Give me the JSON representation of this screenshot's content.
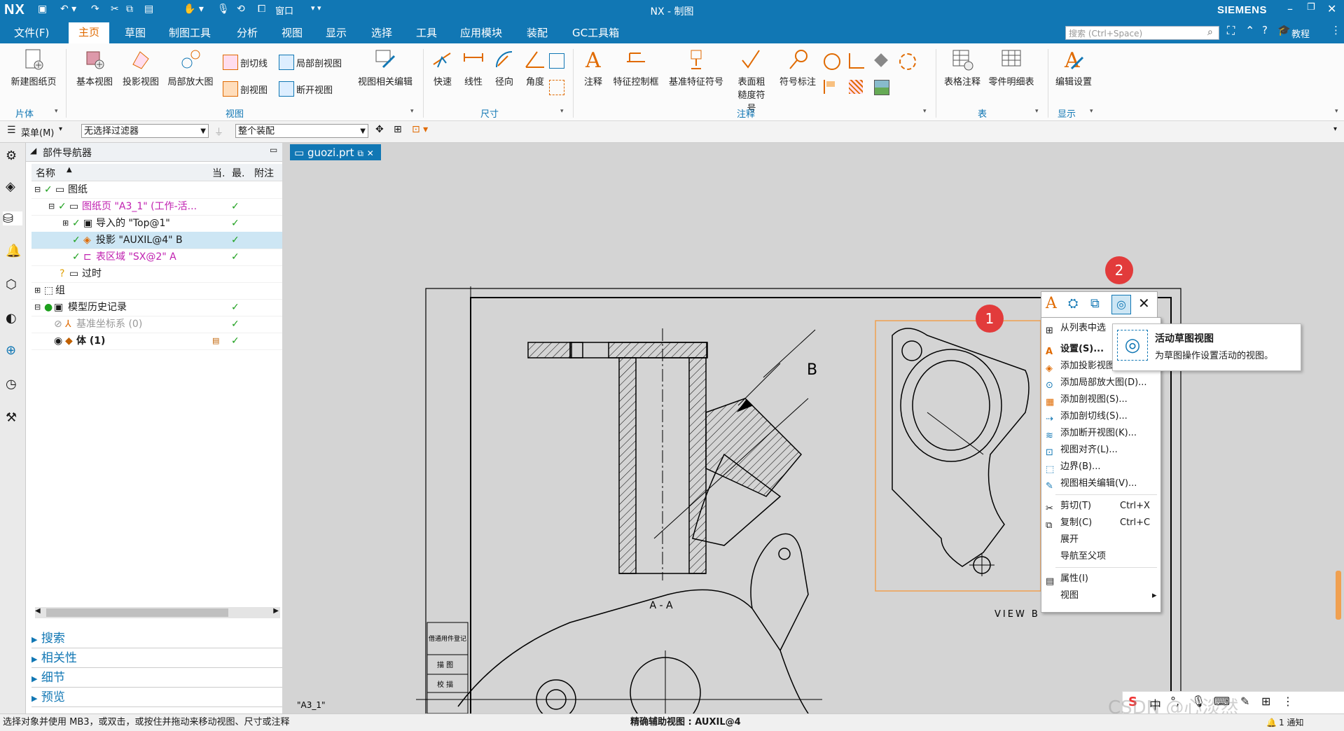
{
  "app": {
    "logo": "NX",
    "window_title": "NX - 制图",
    "brand": "SIEMENS",
    "window_menu": "窗口"
  },
  "menu": {
    "tabs": [
      "文件(F)",
      "主页",
      "草图",
      "制图工具",
      "分析",
      "视图",
      "显示",
      "选择",
      "工具",
      "应用模块",
      "装配",
      "GC工具箱"
    ],
    "active": "主页",
    "search_placeholder": "搜索 (Ctrl+Space)",
    "tutorial": "教程"
  },
  "ribbon": {
    "sheet": {
      "new_sheet": "新建图纸页",
      "group": "片体"
    },
    "view": {
      "base_view": "基本视图",
      "projected_view": "投影视图",
      "detail_view": "局部放大图",
      "section_line": "剖切线",
      "section_view": "剖视图",
      "local_section": "局部剖视图",
      "break_view": "断开视图",
      "view_edit": "视图相关编辑",
      "group": "视图"
    },
    "dimension": {
      "rapid": "快速",
      "linear": "线性",
      "radial": "径向",
      "angular": "角度",
      "group": "尺寸"
    },
    "annotation": {
      "note": "注释",
      "fcf": "特征控制框",
      "datum": "基准特征符号",
      "surface_finish": "表面粗糙度符号",
      "id_symbol": "符号标注",
      "group": "注释"
    },
    "table": {
      "tabular_note": "表格注释",
      "parts_list": "零件明细表",
      "group": "表"
    },
    "display": {
      "edit_settings": "编辑设置",
      "group": "显示"
    }
  },
  "filterbar": {
    "menu_label": "菜单(M)",
    "filter": "无选择过滤器",
    "scope": "整个装配"
  },
  "navigator": {
    "title": "部件导航器",
    "columns": [
      "名称",
      "当.",
      "最.",
      "附注"
    ],
    "rows": [
      {
        "label": "图纸",
        "check": "✓",
        "color": "#222"
      },
      {
        "label": "图纸页 \"A3_1\" (工作-活...",
        "check": "✓",
        "color": "#c020b0"
      },
      {
        "label": "导入的 \"Top@1\"",
        "check": "✓",
        "color": "#222"
      },
      {
        "label": "投影 \"AUXIL@4\" B",
        "check": "✓",
        "color": "#222"
      },
      {
        "label": "表区域 \"SX@2\" A",
        "check": "✓",
        "color": "#c020b0"
      },
      {
        "label": "过时",
        "check": "",
        "color": "#222"
      },
      {
        "label": "组",
        "check": "",
        "color": "#222"
      },
      {
        "label": "模型历史记录",
        "check": "✓",
        "color": "#222"
      },
      {
        "label": "基准坐标系 (0)",
        "check": "✓",
        "color": "#999"
      },
      {
        "label": "体 (1)",
        "check": "✓",
        "color": "#222"
      }
    ],
    "sections": [
      "搜索",
      "相关性",
      "细节",
      "预览"
    ]
  },
  "document": {
    "tab": "guozi.prt",
    "sheet_label": "\"A3_1\"",
    "section_label": "A - A",
    "view_label": "VIEW  B",
    "arrow_label": "B",
    "title_block": [
      "借通用件登记",
      "描  图",
      "校  描"
    ]
  },
  "context_menu": {
    "items": [
      {
        "label": "从列表中选",
        "shortcut": ""
      },
      {
        "label": "设置(S)...",
        "shortcut": ""
      },
      {
        "label": "添加投影视图(J)...",
        "shortcut": ""
      },
      {
        "label": "添加局部放大图(D)...",
        "shortcut": ""
      },
      {
        "label": "添加剖视图(S)...",
        "shortcut": ""
      },
      {
        "label": "添加剖切线(S)...",
        "shortcut": ""
      },
      {
        "label": "添加断开视图(K)...",
        "shortcut": ""
      },
      {
        "label": "视图对齐(L)...",
        "shortcut": ""
      },
      {
        "label": "边界(B)...",
        "shortcut": ""
      },
      {
        "label": "视图相关编辑(V)...",
        "shortcut": ""
      },
      {
        "label": "剪切(T)",
        "shortcut": "Ctrl+X"
      },
      {
        "label": "复制(C)",
        "shortcut": "Ctrl+C"
      },
      {
        "label": "展开",
        "shortcut": ""
      },
      {
        "label": "导航至父项",
        "shortcut": ""
      },
      {
        "label": "属性(I)",
        "shortcut": ""
      },
      {
        "label": "视图",
        "shortcut": ""
      }
    ]
  },
  "tooltip": {
    "title": "活动草图视图",
    "desc": "为草图操作设置活动的视图。"
  },
  "badges": [
    "1",
    "2"
  ],
  "status": {
    "left": "选择对象并使用 MB3，或双击，或按住并拖动来移动视图、尺寸或注释",
    "center": "精确辅助视图 : AUXIL@4",
    "notify": "1 通知"
  },
  "ime": {
    "lang": "中"
  },
  "watermark": "CSDN @心淡然"
}
